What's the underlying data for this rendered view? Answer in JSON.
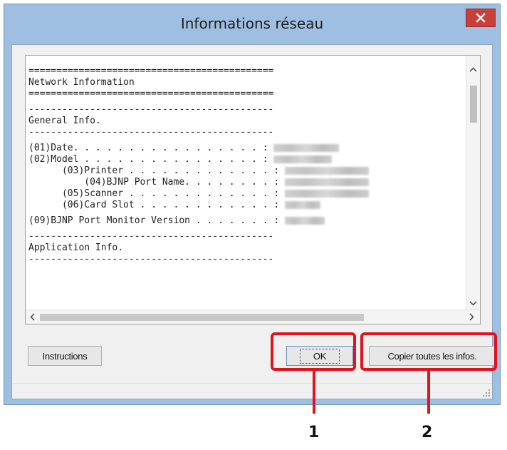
{
  "window": {
    "title": "Informations réseau"
  },
  "info_text": {
    "separator": "============================================",
    "dashes": "--------------------------------------------",
    "heading_network": "Network Information",
    "heading_general": "General Info.",
    "heading_application": "Application Info.",
    "rows": [
      {
        "label": "(01)Date. . . . . . . . . . . . . . . . . :",
        "indent": 0
      },
      {
        "label": "(02)Model . . . . . . . . . . . . . . . . :",
        "indent": 0
      },
      {
        "label": "(03)Printer . . . . . . . . . . . . . :",
        "indent": 1
      },
      {
        "label": "(04)BJNP Port Name. . . . . . . . :",
        "indent": 2
      },
      {
        "label": "(05)Scanner . . . . . . . . . . . . . :",
        "indent": 1
      },
      {
        "label": "(06)Card Slot . . . . . . . . . . . . :",
        "indent": 1
      }
    ],
    "port_monitor": "(09)BJNP Port Monitor Version . . . . . . . :"
  },
  "buttons": {
    "instructions": "Instructions",
    "ok": "OK",
    "copy_all": "Copier toutes les infos."
  },
  "callouts": {
    "first": "1",
    "second": "2"
  },
  "colors": {
    "title_bar": "#9fbfe2",
    "close_button": "#c7403a",
    "callout": "#e0141e"
  }
}
